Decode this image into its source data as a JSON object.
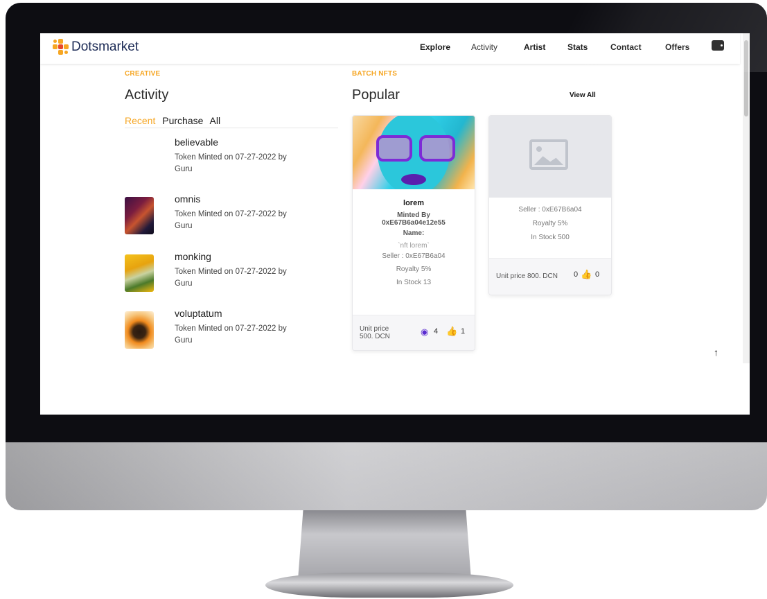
{
  "brand": {
    "name": "Dotsmarket"
  },
  "nav": {
    "items": [
      "Explore",
      "Activity",
      "Artist",
      "Stats",
      "Contact",
      "Offers"
    ],
    "active": "Activity"
  },
  "activity": {
    "eyebrow": "CREATIVE",
    "title": "Activity",
    "tabs": [
      "Recent",
      "Purchase",
      "All"
    ],
    "active_tab": "Recent",
    "items": [
      {
        "title": "believable",
        "line1": "Token Minted on 07-27-2022 by",
        "line2": "Guru"
      },
      {
        "title": "omnis",
        "line1": "Token Minted on 07-27-2022 by",
        "line2": "Guru"
      },
      {
        "title": "monking",
        "line1": "Token Minted on 07-27-2022 by",
        "line2": "Guru"
      },
      {
        "title": "voluptatum",
        "line1": "Token Minted on 07-27-2022 by",
        "line2": "Guru"
      }
    ]
  },
  "popular": {
    "eyebrow": "BATCH NFTS",
    "title": "Popular",
    "view_all": "View All",
    "cards": [
      {
        "title": "lorem",
        "minted_by_label": "Minted By",
        "minted_by": "0xE67B6a04e12e55",
        "name_label": "Name:",
        "name": "`nft lorem`",
        "seller": "Seller : 0xE67B6a04",
        "royalty": "Royalty 5%",
        "stock": "In Stock 13",
        "price": "Unit price 500. DCN",
        "views": "4",
        "likes": "1"
      },
      {
        "seller": "Seller : 0xE67B6a04",
        "royalty": "Royalty 5%",
        "stock": "In Stock 500",
        "price": "Unit price 800. DCN",
        "views": "0",
        "likes": "0"
      }
    ]
  },
  "scroll_to_top": "↑",
  "colors": {
    "accent": "#f6a623",
    "brand": "#1b2a55"
  }
}
